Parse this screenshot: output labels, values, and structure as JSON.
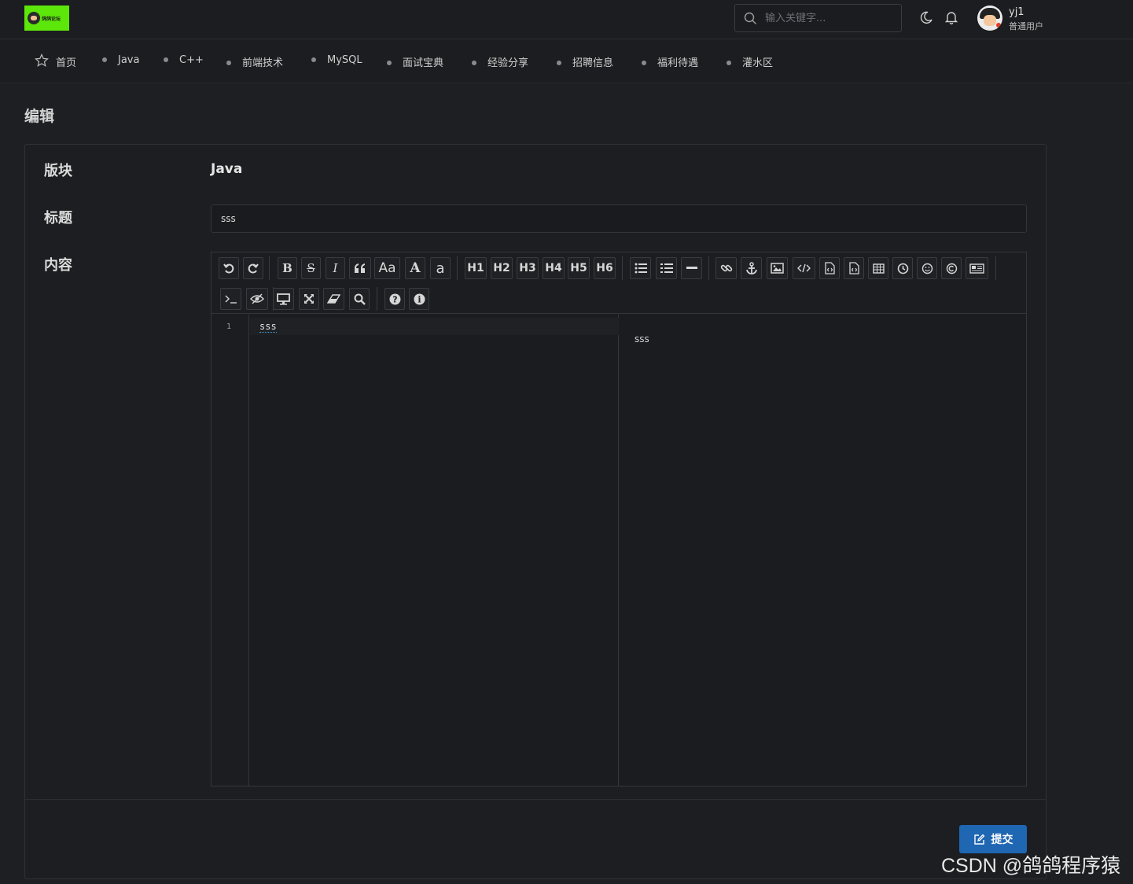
{
  "header": {
    "logo_text": "鸽鸽论坛",
    "search_placeholder": "输入关键字...",
    "user_name": "yj1",
    "user_role": "普通用户",
    "icons": [
      "search-icon",
      "moon-icon",
      "bell-icon"
    ]
  },
  "nav": {
    "items": [
      {
        "label": "首页",
        "icon": "star-icon"
      },
      {
        "label": "Java"
      },
      {
        "label": "C++"
      },
      {
        "label": "前端技术"
      },
      {
        "label": "MySQL"
      },
      {
        "label": "面试宝典"
      },
      {
        "label": "经验分享"
      },
      {
        "label": "招聘信息"
      },
      {
        "label": "福利待遇"
      },
      {
        "label": "灌水区"
      }
    ]
  },
  "page": {
    "title": "编辑"
  },
  "form": {
    "board_label": "版块",
    "board_value": "Java",
    "title_label": "标题",
    "title_value": "sss",
    "content_label": "内容",
    "submit_label": "提交"
  },
  "editor": {
    "line_number": "1",
    "code_text": "sss",
    "preview_text": "sss",
    "toolbar_text": {
      "bold": "B",
      "strike": "S",
      "italic": "I",
      "uppercase": "Aa",
      "A": "A",
      "a": "a",
      "h1": "H1",
      "h2": "H2",
      "h3": "H3",
      "h4": "H4",
      "h5": "H5",
      "h6": "H6"
    }
  },
  "watermark": "CSDN @鸽鸽程序猿",
  "colors": {
    "background": "#1e1f22",
    "logo": "#5ce60a",
    "submit": "#1f66b3"
  }
}
